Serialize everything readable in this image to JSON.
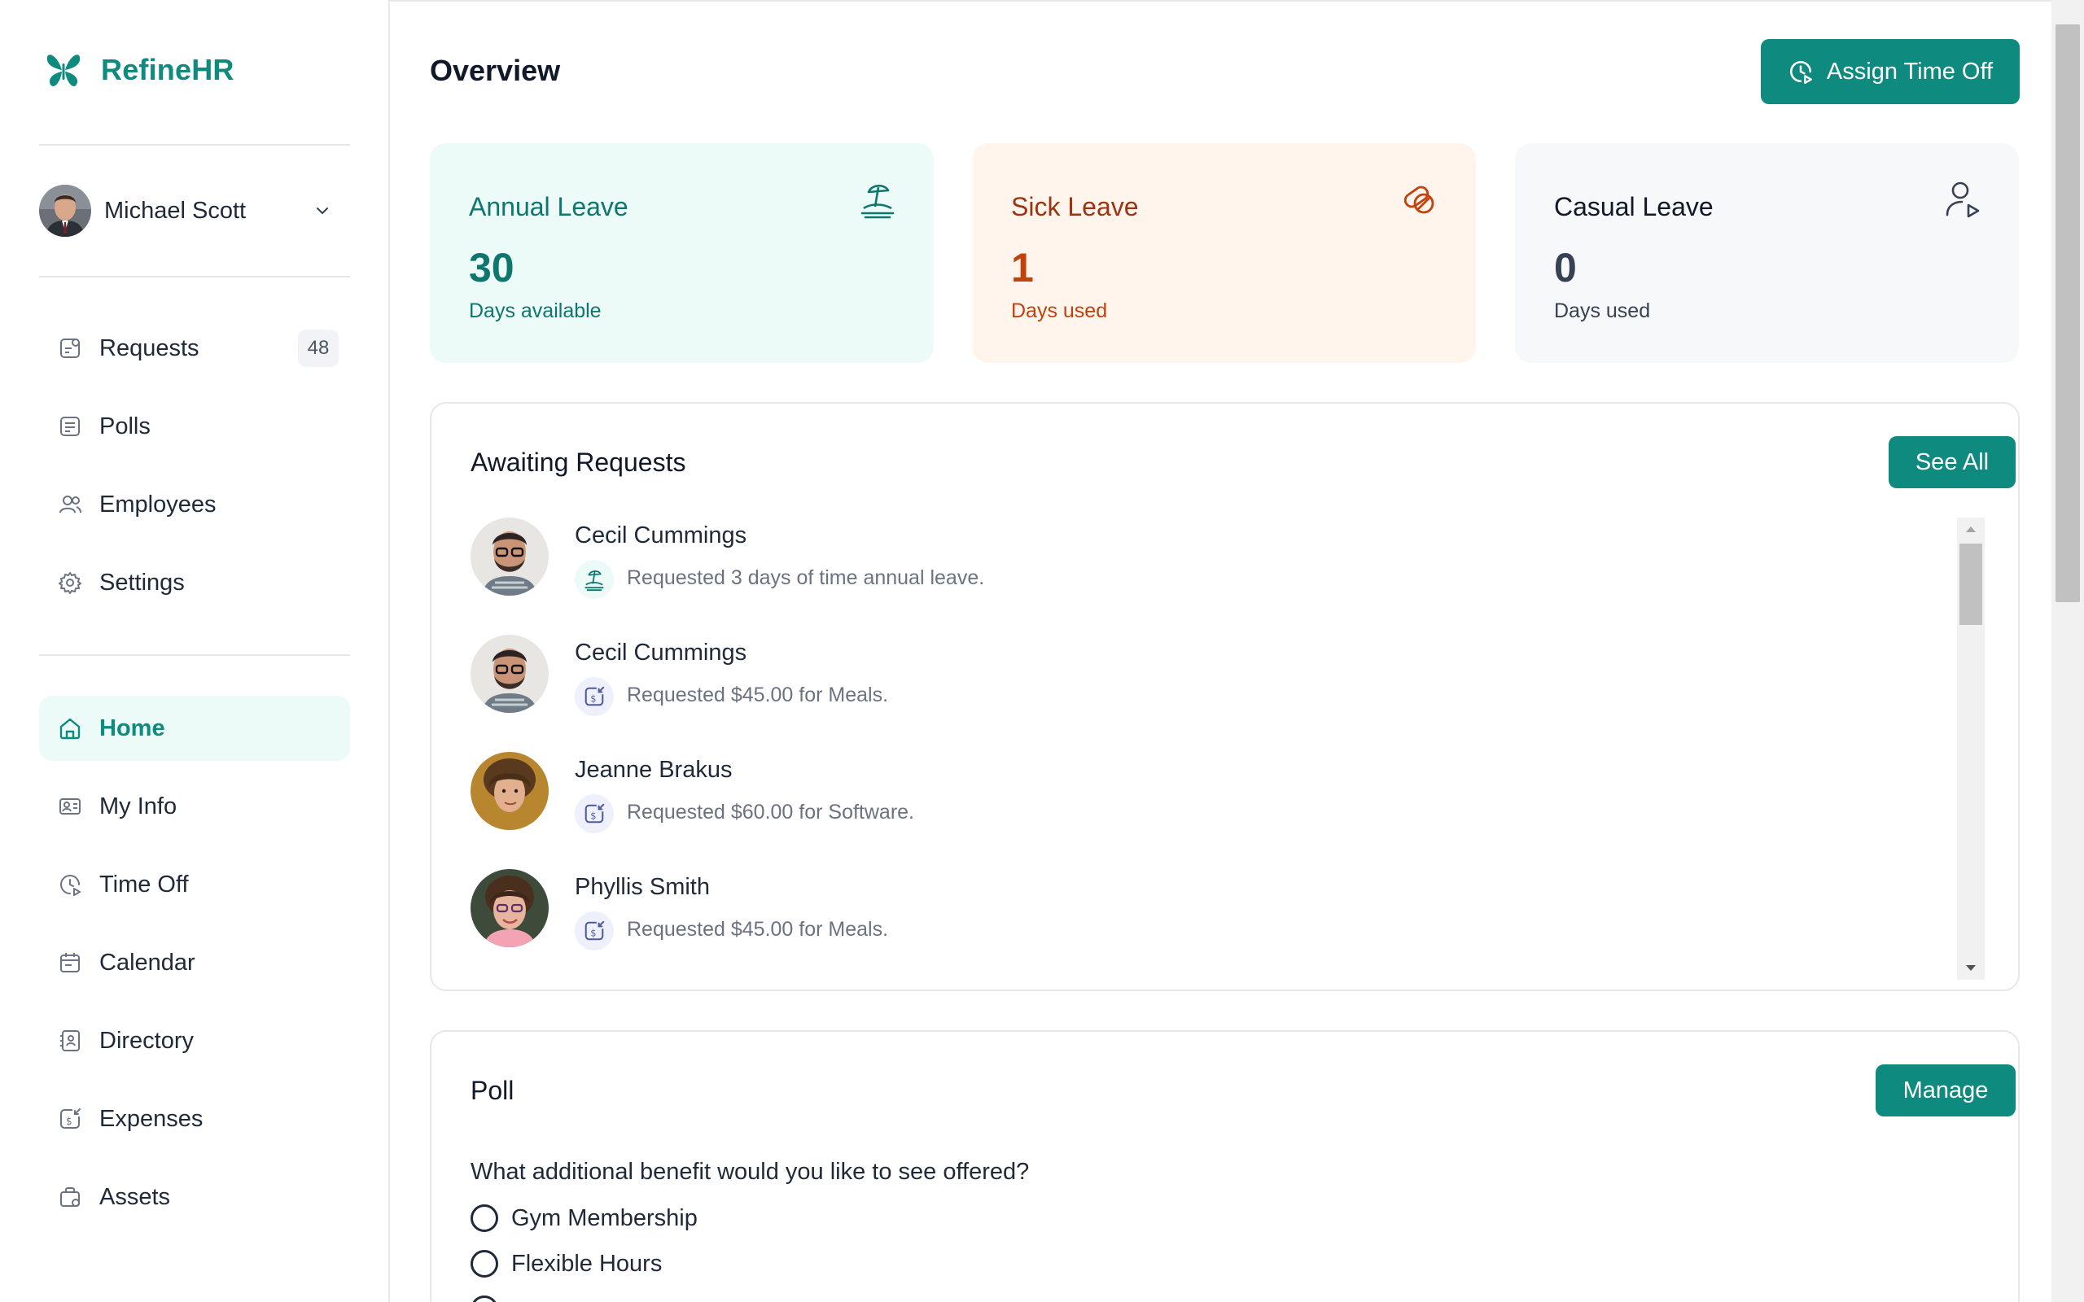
{
  "brand": {
    "name": "RefineHR",
    "logo_icon": "butterfly-logo"
  },
  "user": {
    "name": "Michael Scott"
  },
  "nav_primary": [
    {
      "key": "requests",
      "label": "Requests",
      "badge": "48",
      "icon": "requests-icon"
    },
    {
      "key": "polls",
      "label": "Polls",
      "icon": "polls-icon"
    },
    {
      "key": "employees",
      "label": "Employees",
      "icon": "employees-icon"
    },
    {
      "key": "settings",
      "label": "Settings",
      "icon": "gear-icon"
    }
  ],
  "nav_secondary": [
    {
      "key": "home",
      "label": "Home",
      "active": true,
      "icon": "home-icon"
    },
    {
      "key": "myinfo",
      "label": "My Info",
      "icon": "id-card-icon"
    },
    {
      "key": "timeoff",
      "label": "Time Off",
      "icon": "clock-icon"
    },
    {
      "key": "calendar",
      "label": "Calendar",
      "icon": "calendar-icon"
    },
    {
      "key": "directory",
      "label": "Directory",
      "icon": "contact-book-icon"
    },
    {
      "key": "expenses",
      "label": "Expenses",
      "icon": "receipt-dollar-icon"
    },
    {
      "key": "assets",
      "label": "Assets",
      "icon": "briefcase-icon"
    }
  ],
  "header": {
    "title": "Overview",
    "assign_label": "Assign Time Off"
  },
  "cards": {
    "annual": {
      "title": "Annual Leave",
      "value": "30",
      "sub": "Days available",
      "icon": "beach-icon"
    },
    "sick": {
      "title": "Sick Leave",
      "value": "1",
      "sub": "Days used",
      "icon": "pill-icon"
    },
    "casual": {
      "title": "Casual Leave",
      "value": "0",
      "sub": "Days used",
      "icon": "user-play-icon"
    }
  },
  "awaiting": {
    "title": "Awaiting Requests",
    "see_all_label": "See All",
    "items": [
      {
        "name": "Cecil Cummings",
        "text": "Requested 3 days of time annual leave.",
        "type": "time-off"
      },
      {
        "name": "Cecil Cummings",
        "text": "Requested $45.00 for Meals.",
        "type": "expense"
      },
      {
        "name": "Jeanne Brakus",
        "text": "Requested $60.00 for Software.",
        "type": "expense"
      },
      {
        "name": "Phyllis Smith",
        "text": "Requested $45.00 for Meals.",
        "type": "expense"
      }
    ]
  },
  "poll": {
    "title": "Poll",
    "manage_label": "Manage",
    "question": "What additional benefit would you like to see offered?",
    "options": [
      "Gym Membership",
      "Flexible Hours"
    ]
  },
  "colors": {
    "accent": "#0f8a7e",
    "sick": "#c2410c",
    "annual_bg": "#ecfbf8",
    "sick_bg": "#fff5ed"
  }
}
